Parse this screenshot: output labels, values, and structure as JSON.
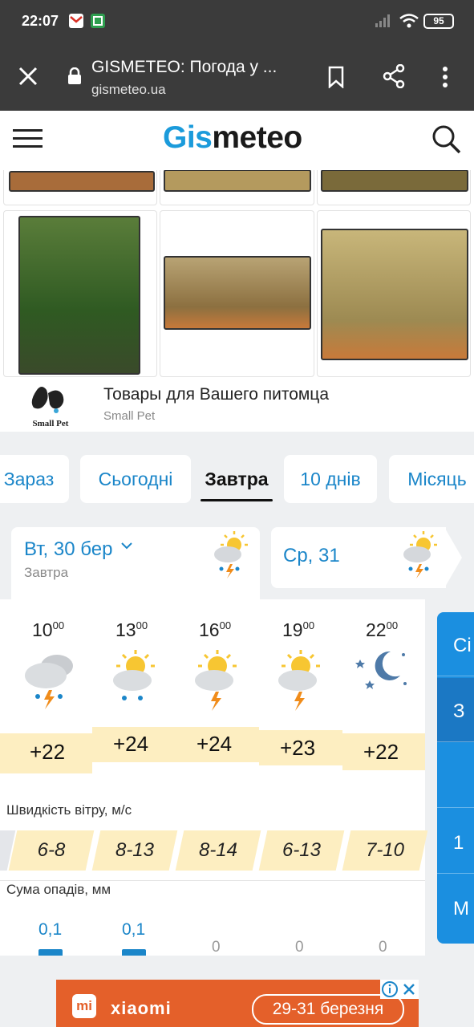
{
  "status_bar": {
    "time": "22:07",
    "battery": "95"
  },
  "browser": {
    "title": "GISMETEO: Погода у ...",
    "url": "gismeteo.ua"
  },
  "site": {
    "logo_part1": "Gis",
    "logo_part2": "meteo"
  },
  "ad": {
    "title": "Товары для Вашего питомца",
    "subtitle": "Small Pet",
    "logo_text": "Small Pet"
  },
  "tabs": [
    {
      "label": "Зараз",
      "active": false
    },
    {
      "label": "Сьогодні",
      "active": false
    },
    {
      "label": "Завтра",
      "active": true
    },
    {
      "label": "10 днів",
      "active": false
    },
    {
      "label": "Місяць",
      "active": false
    }
  ],
  "day_cards": [
    {
      "day": "Вт, 30 бер",
      "sub": "Завтра",
      "icon": "sun-cloud-rain-thunder-icon"
    },
    {
      "day": "Ср, 31",
      "icon": "sun-cloud-rain-thunder-icon"
    }
  ],
  "hours": [
    {
      "hour": "10",
      "min": "00",
      "icon": "cloud-rain-thunder-icon",
      "temp": "+22",
      "temp_value": 22,
      "wind": "6-8",
      "precip": "0,1",
      "precip_value": 0.1
    },
    {
      "hour": "13",
      "min": "00",
      "icon": "sun-cloud-rain-icon",
      "temp": "+24",
      "temp_value": 24,
      "wind": "8-13",
      "precip": "0,1",
      "precip_value": 0.1
    },
    {
      "hour": "16",
      "min": "00",
      "icon": "sun-cloud-thunder-icon",
      "temp": "+24",
      "temp_value": 24,
      "wind": "8-14",
      "precip": "0",
      "precip_value": 0
    },
    {
      "hour": "19",
      "min": "00",
      "icon": "sun-cloud-thunder-icon",
      "temp": "+23",
      "temp_value": 23,
      "wind": "6-13",
      "precip": "0",
      "precip_value": 0
    },
    {
      "hour": "22",
      "min": "00",
      "icon": "moon-stars-icon",
      "temp": "+22",
      "temp_value": 22,
      "wind": "7-10",
      "precip": "0",
      "precip_value": 0
    }
  ],
  "labels": {
    "wind": "Швидкість вітру, м/с",
    "precip": "Сума опадів, мм"
  },
  "side_panel": [
    "Сі",
    "З",
    "",
    "1",
    "М"
  ],
  "bottom_ad": {
    "brand": "xiaomi",
    "dates": "29-31 березня"
  },
  "colors": {
    "accent": "#1b86c9",
    "temp_band": "#fdeec1",
    "side_panel": "#1b8fe0",
    "status_bar": "#3b3b3b",
    "ad_orange": "#e4602a"
  }
}
